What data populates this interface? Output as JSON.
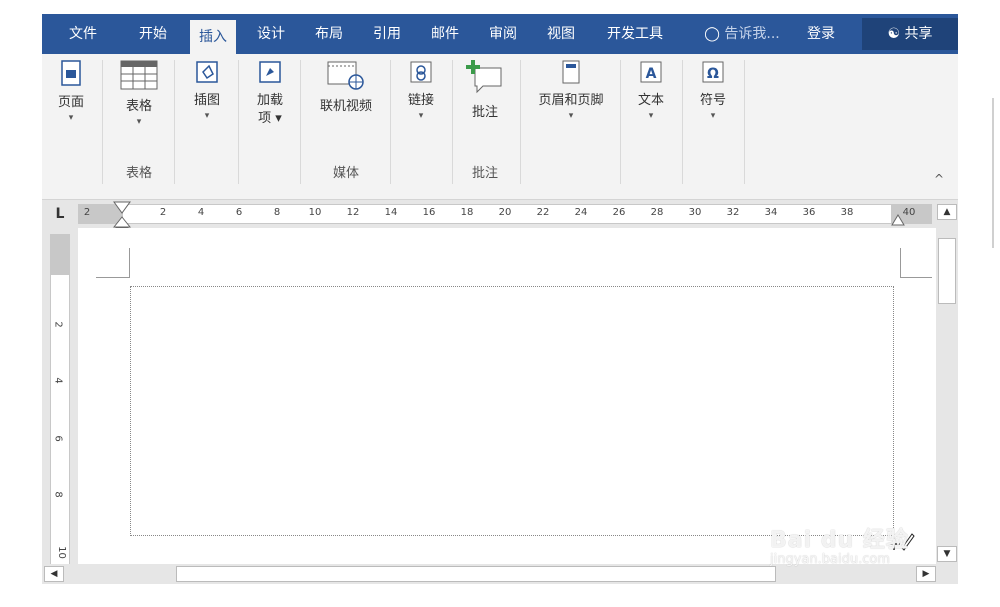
{
  "tabs": [
    {
      "label": "文件"
    },
    {
      "label": "开始"
    },
    {
      "label": "插入"
    },
    {
      "label": "设计"
    },
    {
      "label": "布局"
    },
    {
      "label": "引用"
    },
    {
      "label": "邮件"
    },
    {
      "label": "审阅"
    },
    {
      "label": "视图"
    },
    {
      "label": "开发工具"
    }
  ],
  "active_tab": "插入",
  "tell_me": "告诉我...",
  "login": "登录",
  "share": "共享",
  "ribbon": {
    "page": "页面",
    "table": "表格",
    "illustration": "插图",
    "addins": "加载",
    "addins2": "项",
    "online_video": "联机视频",
    "link": "链接",
    "comment": "批注",
    "header_footer": "页眉和页脚",
    "text": "文本",
    "symbol": "符号"
  },
  "groups": {
    "table": "表格",
    "media": "媒体",
    "comments": "批注"
  },
  "ruler_corner": "L",
  "h_ticks": [
    "2",
    "2",
    "4",
    "6",
    "8",
    "10",
    "12",
    "14",
    "16",
    "18",
    "20",
    "22",
    "24",
    "26",
    "28",
    "30",
    "32",
    "34",
    "36",
    "38",
    "40"
  ],
  "v_ticks": [
    "2",
    "4",
    "6",
    "8",
    "10"
  ],
  "watermark": {
    "top": "Bai du 经验",
    "bottom": "jingyan.baidu.com"
  },
  "colors": {
    "title_bar": "#2b579a",
    "ribbon": "#f3f3f3",
    "canvas": "#e6e6e6"
  }
}
